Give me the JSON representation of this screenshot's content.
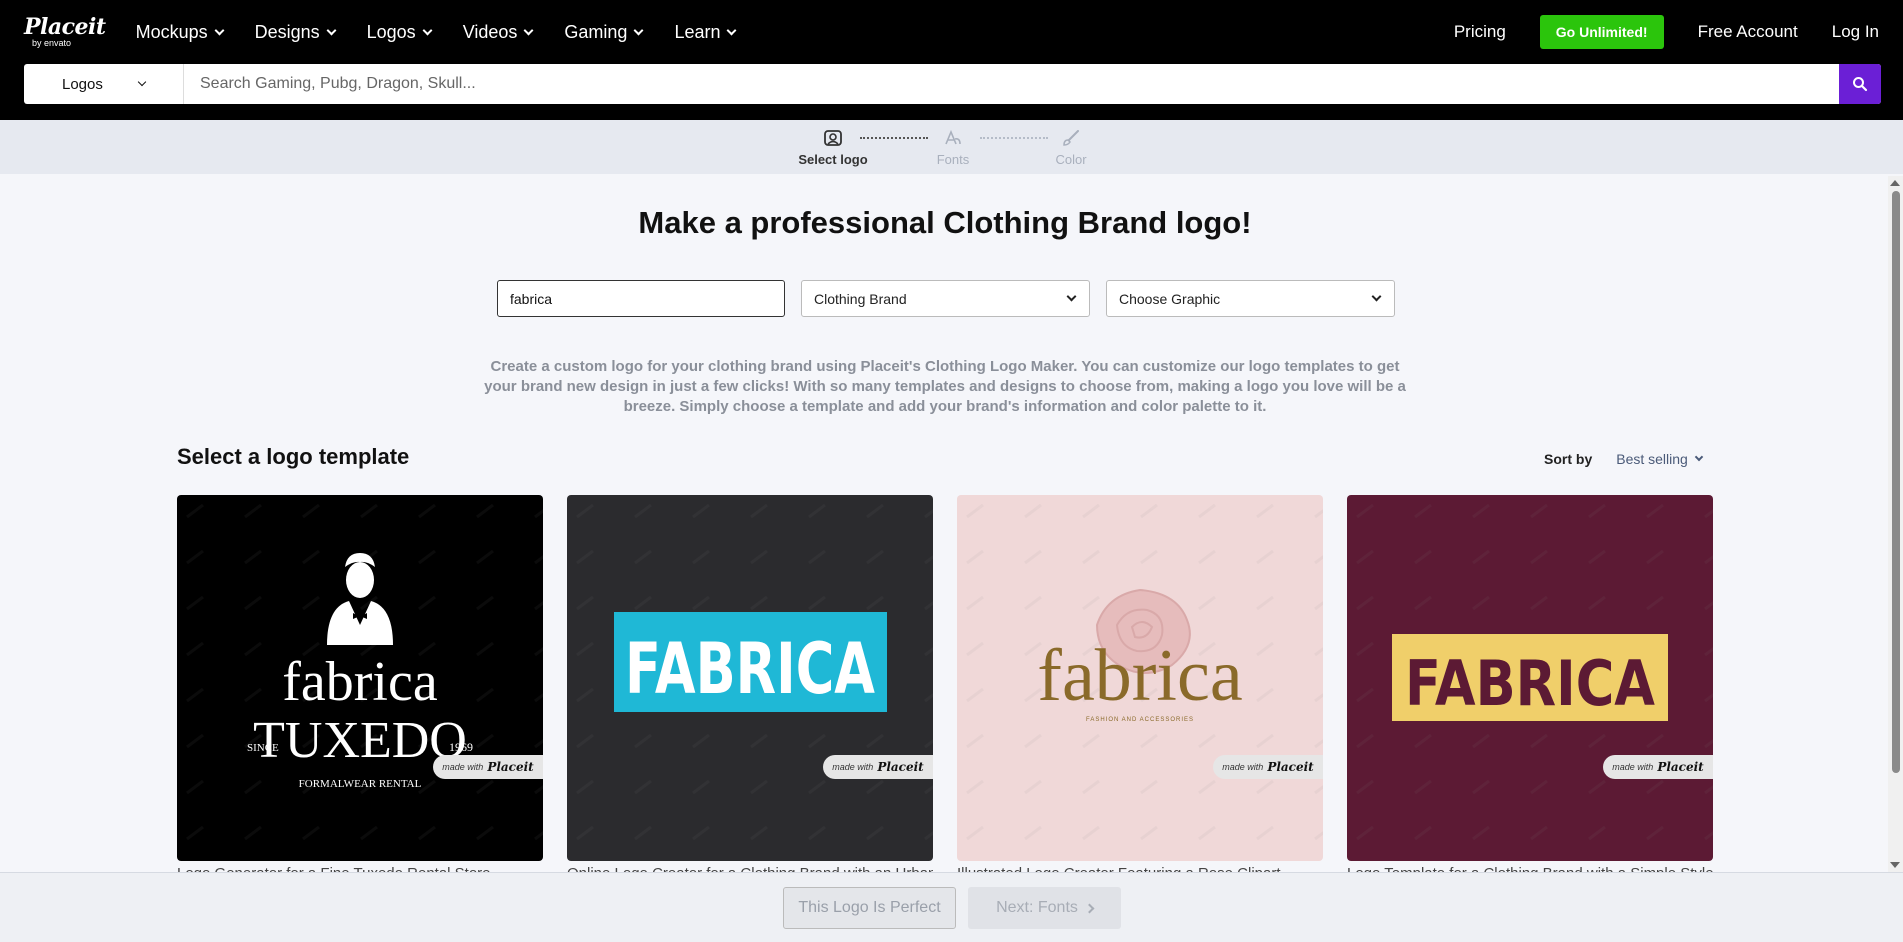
{
  "brand": {
    "name": "Placeit",
    "sub": "by envato"
  },
  "nav": {
    "items": [
      {
        "label": "Mockups"
      },
      {
        "label": "Designs"
      },
      {
        "label": "Logos"
      },
      {
        "label": "Videos"
      },
      {
        "label": "Gaming"
      },
      {
        "label": "Learn"
      }
    ],
    "pricing": "Pricing",
    "go_unlimited": "Go Unlimited!",
    "free_account": "Free Account",
    "login": "Log In"
  },
  "search": {
    "category": "Logos",
    "placeholder": "Search Gaming, Pubg, Dragon, Skull..."
  },
  "stepper": {
    "steps": [
      {
        "label": "Select logo",
        "active": true
      },
      {
        "label": "Fonts",
        "active": false
      },
      {
        "label": "Color",
        "active": false
      }
    ]
  },
  "main": {
    "headline": "Make a professional Clothing Brand logo!",
    "filters": {
      "name_value": "fabrica",
      "industry": "Clothing Brand",
      "graphic": "Choose Graphic"
    },
    "description": "Create a custom logo for your clothing brand using Placeit's Clothing Logo Maker. You can customize our logo templates to get your brand new design in just a few clicks! With so many templates and designs to choose from, making a logo you love will be a breeze. Simply choose a template and add your brand's information and color palette to it.",
    "section_title": "Select a logo template",
    "sort_label": "Sort by",
    "sort_value": "Best selling"
  },
  "cards": [
    {
      "bg": "#000000",
      "text_main": "fabrica",
      "text_second": "TUXEDO",
      "since": "SINCE",
      "year": "1969",
      "tagline": "FORMALWEAR RENTAL",
      "caption": "Logo Generator for a Fine Tuxedo Rental Store"
    },
    {
      "bg": "#2b2b2e",
      "text_main": "FABRICA",
      "accent": "#1fb8d6",
      "caption": "Online Logo Creator for a Clothing Brand with an Urban Look"
    },
    {
      "bg": "#f0d8d8",
      "text_main": "fabrica",
      "tagline": "FASHION AND ACCESSORIES",
      "accent": "#8a6a2a",
      "caption": "Illustrated Logo Creator Featuring a Rose Clipart"
    },
    {
      "bg": "#5c1a34",
      "text_main": "FABRICA",
      "accent": "#f0cf6a",
      "caption": "Logo Template for a Clothing Brand with a Simple Style"
    }
  ],
  "watermark": {
    "prefix": "made with",
    "brand": "Placeit"
  },
  "bottom": {
    "perfect": "This Logo Is Perfect",
    "next": "Next: Fonts"
  }
}
